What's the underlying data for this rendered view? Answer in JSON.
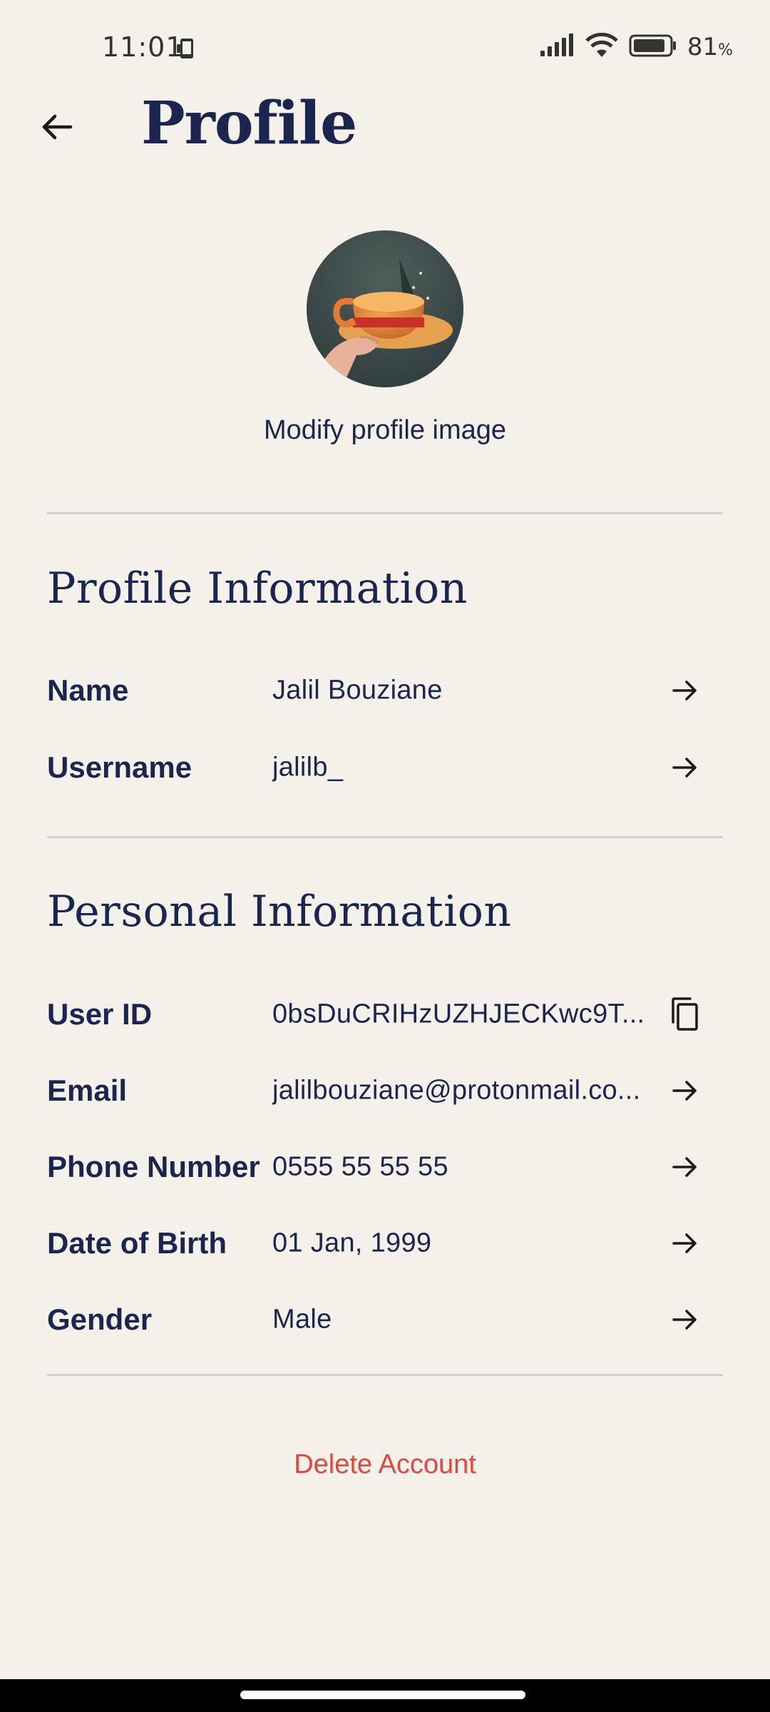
{
  "status_bar": {
    "time": "11:01",
    "battery_percent": "81",
    "battery_unit": "%",
    "icons": [
      "phone-icon",
      "signal-icon",
      "wifi-icon",
      "battery-icon"
    ]
  },
  "header": {
    "title": "Profile",
    "back_icon": "arrow-left-icon"
  },
  "avatar": {
    "modify_label": "Modify profile image"
  },
  "profile_section": {
    "title": "Profile Information",
    "rows": [
      {
        "label": "Name",
        "value": "Jalil Bouziane",
        "action_icon": "arrow-right-icon"
      },
      {
        "label": "Username",
        "value": "jalilb_",
        "action_icon": "arrow-right-icon"
      }
    ]
  },
  "personal_section": {
    "title": "Personal Information",
    "rows": [
      {
        "label": "User ID",
        "value": "0bsDuCRIHzUZHJECKwc9T...",
        "action_icon": "copy-icon"
      },
      {
        "label": "Email",
        "value": "jalilbouziane@protonmail.co...",
        "action_icon": "arrow-right-icon"
      },
      {
        "label": "Phone Number",
        "value": "0555 55 55 55",
        "action_icon": "arrow-right-icon"
      },
      {
        "label": "Date of Birth",
        "value": "01 Jan, 1999",
        "action_icon": "arrow-right-icon"
      },
      {
        "label": "Gender",
        "value": "Male",
        "action_icon": "arrow-right-icon"
      }
    ]
  },
  "delete_account_label": "Delete Account",
  "colors": {
    "background": "#F4F1EA",
    "primary_text": "#1B2550",
    "danger": "#E2473E",
    "divider": "#D2D0CC"
  }
}
